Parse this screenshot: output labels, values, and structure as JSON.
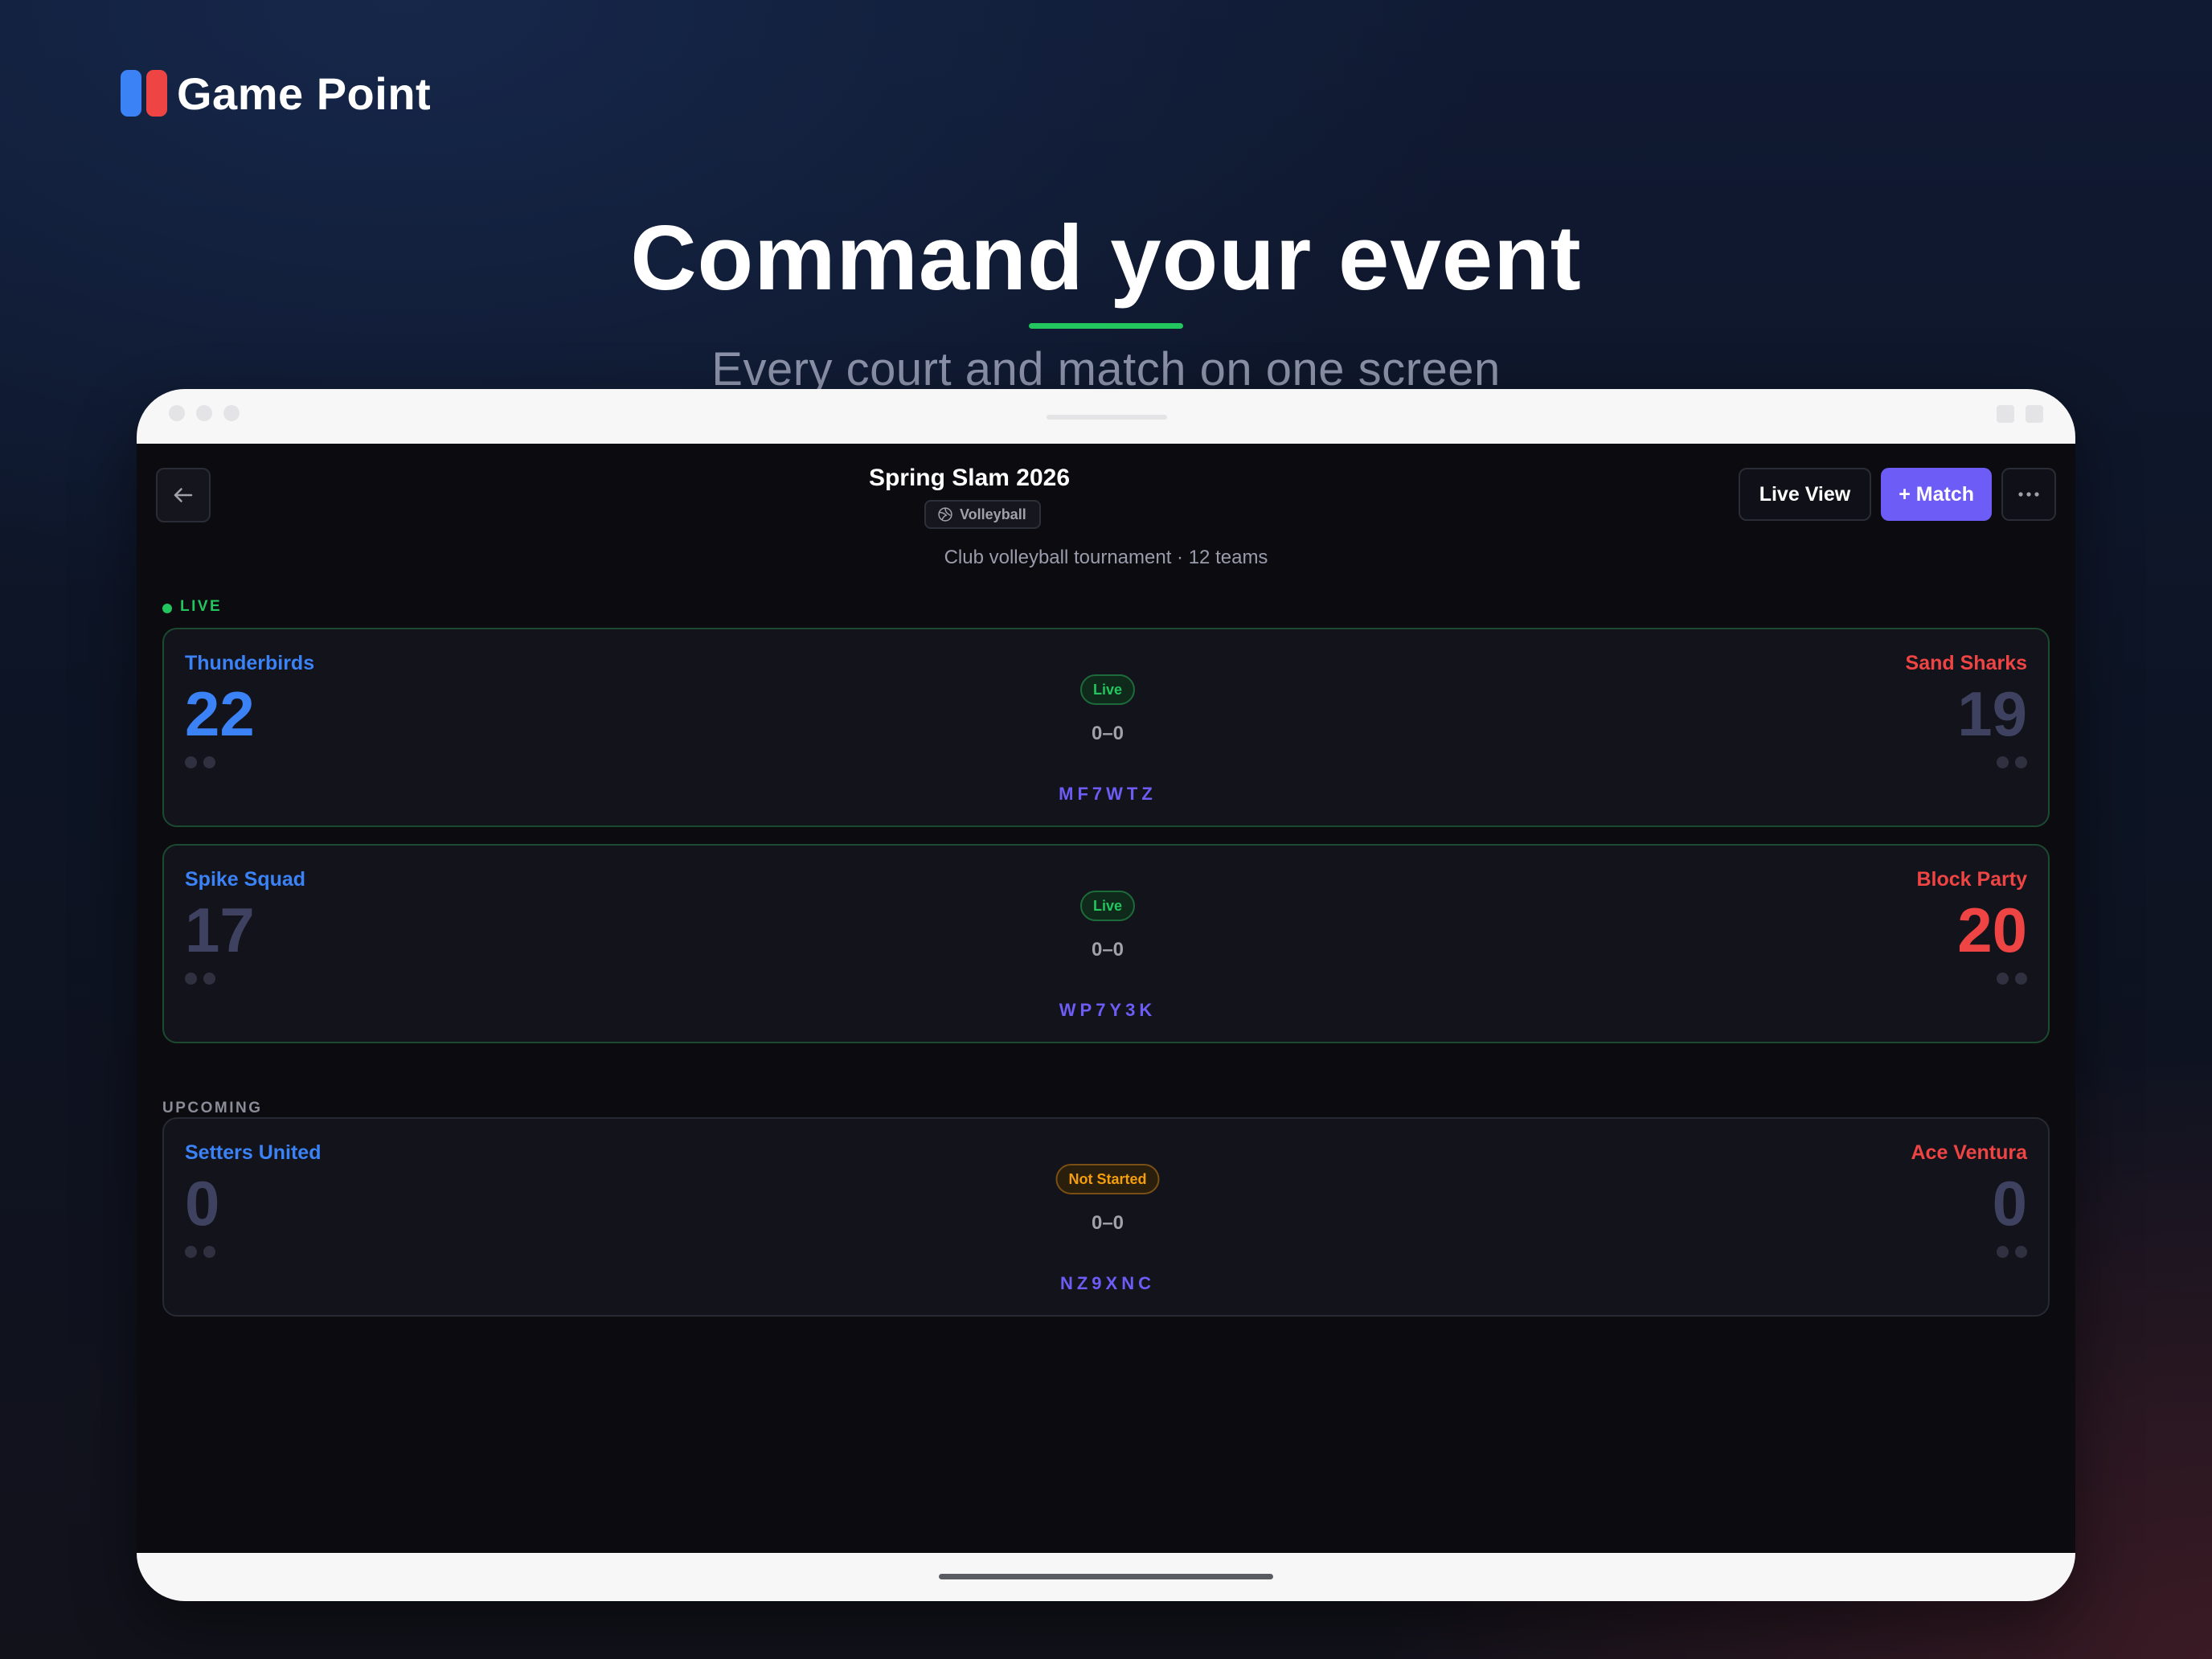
{
  "brand": {
    "name": "Game Point",
    "colors": {
      "left": "#3b82f6",
      "right": "#ef4444"
    }
  },
  "hero": {
    "title": "Command your event",
    "subtitle": "Every court and match on one screen",
    "underline_color": "#22c55e"
  },
  "app": {
    "back_icon": "arrow-left-icon",
    "event": {
      "title": "Spring Slam 2026",
      "sport": "Volleyball",
      "sport_icon": "volleyball-icon",
      "description": "Club volleyball tournament · 12 teams"
    },
    "actions": {
      "live_view_label": "Live View",
      "add_match_label": "+ Match",
      "more_icon": "more-horizontal-icon"
    },
    "sections": {
      "live_label": "LIVE",
      "upcoming_label": "UPCOMING"
    },
    "live_matches": [
      {
        "home": {
          "name": "Thunderbirds",
          "score": "22"
        },
        "away": {
          "name": "Sand Sharks",
          "score": "19"
        },
        "status": "Live",
        "sets": "0–0",
        "code": "MF7WTZ"
      },
      {
        "home": {
          "name": "Spike Squad",
          "score": "17"
        },
        "away": {
          "name": "Block Party",
          "score": "20"
        },
        "status": "Live",
        "sets": "0–0",
        "code": "WP7Y3K"
      }
    ],
    "upcoming_matches": [
      {
        "home": {
          "name": "Setters United",
          "score": "0"
        },
        "away": {
          "name": "Ace Ventura",
          "score": "0"
        },
        "status": "Not Started",
        "sets": "0–0",
        "code": "NZ9XNC"
      }
    ],
    "colors": {
      "accent": "#6d5cf6",
      "home_team": "#3b82f6",
      "away_team": "#ef4444",
      "live": "#22c55e",
      "pending": "#f59e0b"
    }
  }
}
